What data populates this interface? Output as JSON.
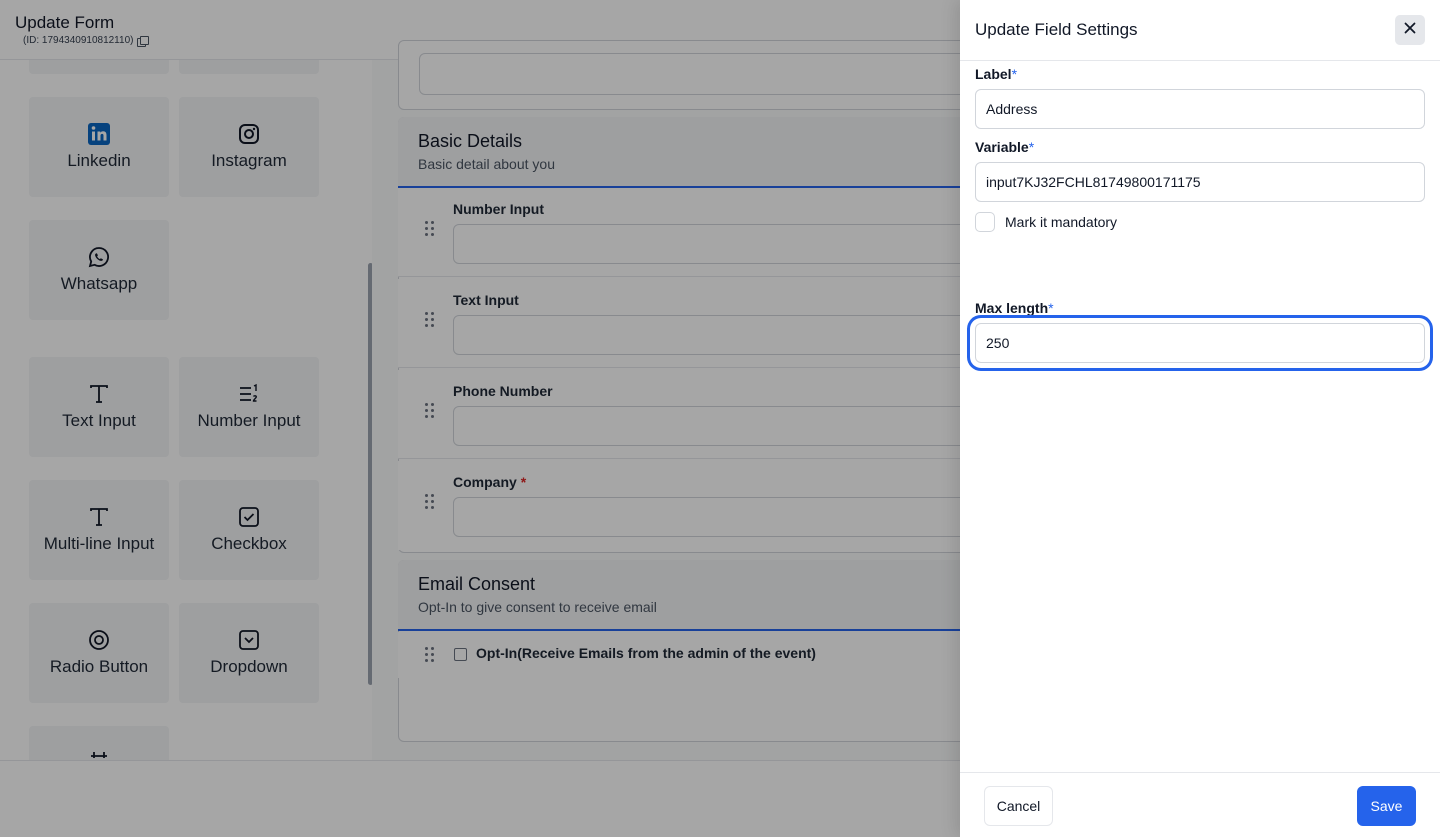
{
  "header": {
    "title": "Update Form",
    "form_id": "(ID: 1794340910812110)"
  },
  "palette": {
    "tiles": [
      {
        "label": "Linkedin",
        "icon": "linkedin-icon"
      },
      {
        "label": "Instagram",
        "icon": "instagram-icon"
      },
      {
        "label": "Whatsapp",
        "icon": "whatsapp-icon"
      },
      {
        "label": "Text Input",
        "icon": "text-icon"
      },
      {
        "label": "Number Input",
        "icon": "number-list-icon"
      },
      {
        "label": "Multi-line Input",
        "icon": "text-icon"
      },
      {
        "label": "Checkbox",
        "icon": "checkbox-icon"
      },
      {
        "label": "Radio Button",
        "icon": "radio-icon"
      },
      {
        "label": "Dropdown",
        "icon": "dropdown-icon"
      }
    ]
  },
  "form": {
    "sections": [
      {
        "title": "Basic Details",
        "description": "Basic detail about you",
        "fields": [
          {
            "label": "Number Input",
            "required": false
          },
          {
            "label": "Text Input",
            "required": false
          },
          {
            "label": "Phone Number",
            "required": false
          },
          {
            "label": "Company",
            "required": true,
            "required_mark": "*"
          }
        ]
      },
      {
        "title": "Email Consent",
        "description": "Opt-In to give consent to receive email",
        "consent_label": "Opt-In(Receive Emails from the admin of the event)"
      }
    ]
  },
  "drawer": {
    "title": "Update Field Settings",
    "close_icon": "close-icon",
    "required_star": "*",
    "label_field": {
      "label": "Label",
      "value": "Address"
    },
    "variable_field": {
      "label": "Variable",
      "value": "input7KJ32FCHL81749800171175"
    },
    "mandatory_checkbox": {
      "label": "Mark it mandatory",
      "checked": false
    },
    "max_length_field": {
      "label": "Max length",
      "value": "250"
    },
    "cancel_label": "Cancel",
    "save_label": "Save"
  },
  "colors": {
    "accent": "#2563eb",
    "required_red": "#dc2626",
    "overlay": "rgba(0,0,0,0.35)"
  }
}
